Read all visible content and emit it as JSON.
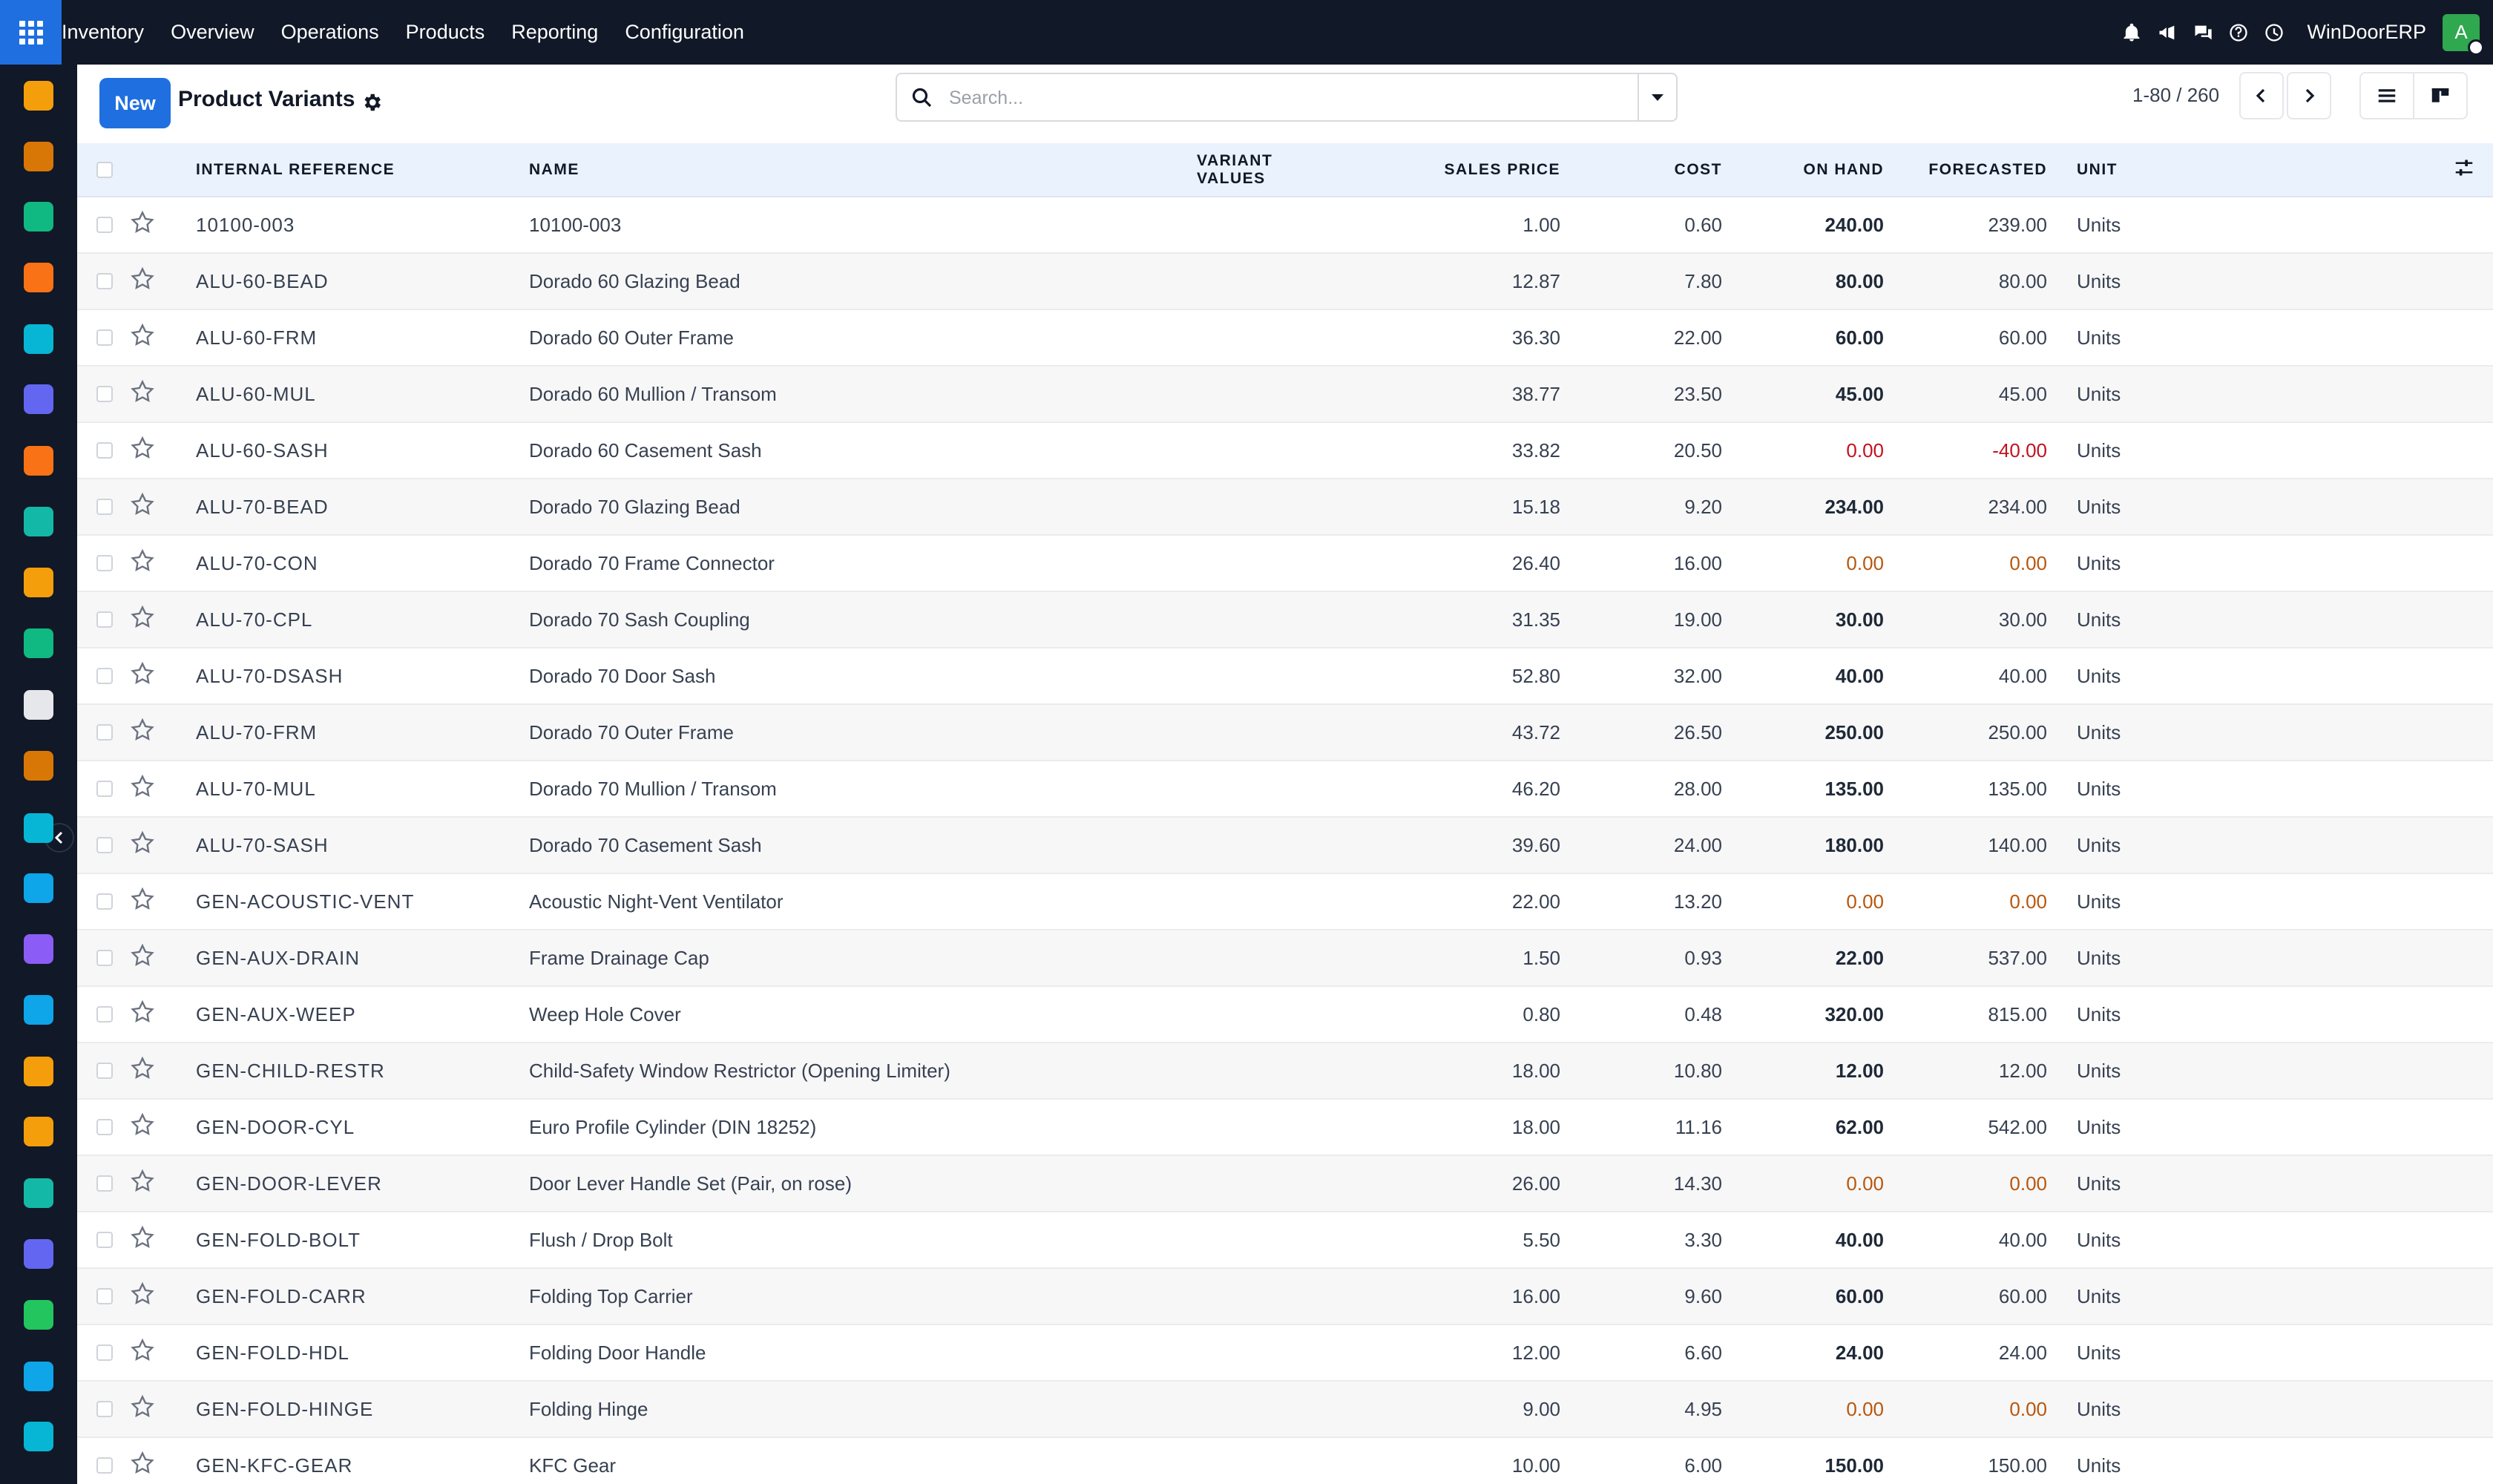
{
  "navbar": {
    "app_name": "Inventory",
    "menus": [
      "Overview",
      "Operations",
      "Products",
      "Reporting",
      "Configuration"
    ],
    "company": "WinDoorERP",
    "avatar_initial": "A",
    "icons": [
      "bell-icon",
      "megaphone-icon",
      "chat-icon",
      "help-icon",
      "clock-icon"
    ]
  },
  "sidebar": {
    "apps": [
      {
        "icon": "sales-chart-icon",
        "color": "#f59e0b"
      },
      {
        "icon": "pos-icon",
        "color": "#d97706"
      },
      {
        "icon": "contacts-icon",
        "color": "#10b981"
      },
      {
        "icon": "discuss-icon",
        "color": "#f97316"
      },
      {
        "icon": "website-icon",
        "color": "#06b6d4"
      },
      {
        "icon": "email-marketing-icon",
        "color": "#6366f1"
      },
      {
        "icon": "livechat-icon",
        "color": "#f97316"
      },
      {
        "icon": "purchase-icon",
        "color": "#14b8a6"
      },
      {
        "icon": "reporting-icon",
        "color": "#f59e0b"
      },
      {
        "icon": "employees-icon",
        "color": "#10b981"
      },
      {
        "icon": "inventory-box-icon",
        "color": "#e5e7eb"
      },
      {
        "icon": "point-of-sale-icon",
        "color": "#d97706"
      },
      {
        "icon": "project-icon",
        "color": "#06b6d4"
      },
      {
        "icon": "knowledge-icon",
        "color": "#0ea5e9"
      },
      {
        "icon": "barcode-icon",
        "color": "#8b5cf6"
      },
      {
        "icon": "invoicing-icon",
        "color": "#0ea5e9"
      },
      {
        "icon": "team-icon",
        "color": "#f59e0b"
      },
      {
        "icon": "calendar-icon",
        "color": "#f59e0b"
      },
      {
        "icon": "sign-icon",
        "color": "#14b8a6"
      },
      {
        "icon": "dashboard-icon",
        "color": "#6366f1"
      },
      {
        "icon": "whatsapp-icon",
        "color": "#22c55e"
      },
      {
        "icon": "timer-icon",
        "color": "#0ea5e9"
      },
      {
        "icon": "website-wave-icon",
        "color": "#06b6d4"
      }
    ]
  },
  "control": {
    "new_label": "New",
    "title": "Product Variants",
    "search_placeholder": "Search...",
    "pager": "1-80 / 260"
  },
  "table": {
    "columns": [
      "INTERNAL REFERENCE",
      "NAME",
      "VARIANT VALUES",
      "SALES PRICE",
      "COST",
      "ON HAND",
      "FORECASTED",
      "UNIT"
    ],
    "rows": [
      {
        "ref": "10100-003",
        "name": "10100-003",
        "variant": "",
        "price": "1.00",
        "cost": "0.60",
        "onhand": "240.00",
        "forecast": "239.00",
        "unit": "Units",
        "status": "ok"
      },
      {
        "ref": "ALU-60-BEAD",
        "name": "Dorado 60 Glazing Bead",
        "variant": "",
        "price": "12.87",
        "cost": "7.80",
        "onhand": "80.00",
        "forecast": "80.00",
        "unit": "Units",
        "status": "ok"
      },
      {
        "ref": "ALU-60-FRM",
        "name": "Dorado 60 Outer Frame",
        "variant": "",
        "price": "36.30",
        "cost": "22.00",
        "onhand": "60.00",
        "forecast": "60.00",
        "unit": "Units",
        "status": "ok"
      },
      {
        "ref": "ALU-60-MUL",
        "name": "Dorado 60 Mullion / Transom",
        "variant": "",
        "price": "38.77",
        "cost": "23.50",
        "onhand": "45.00",
        "forecast": "45.00",
        "unit": "Units",
        "status": "ok"
      },
      {
        "ref": "ALU-60-SASH",
        "name": "Dorado 60 Casement Sash",
        "variant": "",
        "price": "33.82",
        "cost": "20.50",
        "onhand": "0.00",
        "forecast": "-40.00",
        "unit": "Units",
        "status": "negative"
      },
      {
        "ref": "ALU-70-BEAD",
        "name": "Dorado 70 Glazing Bead",
        "variant": "",
        "price": "15.18",
        "cost": "9.20",
        "onhand": "234.00",
        "forecast": "234.00",
        "unit": "Units",
        "status": "ok"
      },
      {
        "ref": "ALU-70-CON",
        "name": "Dorado 70 Frame Connector",
        "variant": "",
        "price": "26.40",
        "cost": "16.00",
        "onhand": "0.00",
        "forecast": "0.00",
        "unit": "Units",
        "status": "zero"
      },
      {
        "ref": "ALU-70-CPL",
        "name": "Dorado 70 Sash Coupling",
        "variant": "",
        "price": "31.35",
        "cost": "19.00",
        "onhand": "30.00",
        "forecast": "30.00",
        "unit": "Units",
        "status": "ok"
      },
      {
        "ref": "ALU-70-DSASH",
        "name": "Dorado 70 Door Sash",
        "variant": "",
        "price": "52.80",
        "cost": "32.00",
        "onhand": "40.00",
        "forecast": "40.00",
        "unit": "Units",
        "status": "ok"
      },
      {
        "ref": "ALU-70-FRM",
        "name": "Dorado 70 Outer Frame",
        "variant": "",
        "price": "43.72",
        "cost": "26.50",
        "onhand": "250.00",
        "forecast": "250.00",
        "unit": "Units",
        "status": "ok"
      },
      {
        "ref": "ALU-70-MUL",
        "name": "Dorado 70 Mullion / Transom",
        "variant": "",
        "price": "46.20",
        "cost": "28.00",
        "onhand": "135.00",
        "forecast": "135.00",
        "unit": "Units",
        "status": "ok"
      },
      {
        "ref": "ALU-70-SASH",
        "name": "Dorado 70 Casement Sash",
        "variant": "",
        "price": "39.60",
        "cost": "24.00",
        "onhand": "180.00",
        "forecast": "140.00",
        "unit": "Units",
        "status": "ok"
      },
      {
        "ref": "GEN-ACOUSTIC-VENT",
        "name": "Acoustic Night-Vent Ventilator",
        "variant": "",
        "price": "22.00",
        "cost": "13.20",
        "onhand": "0.00",
        "forecast": "0.00",
        "unit": "Units",
        "status": "zero"
      },
      {
        "ref": "GEN-AUX-DRAIN",
        "name": "Frame Drainage Cap",
        "variant": "",
        "price": "1.50",
        "cost": "0.93",
        "onhand": "22.00",
        "forecast": "537.00",
        "unit": "Units",
        "status": "ok"
      },
      {
        "ref": "GEN-AUX-WEEP",
        "name": "Weep Hole Cover",
        "variant": "",
        "price": "0.80",
        "cost": "0.48",
        "onhand": "320.00",
        "forecast": "815.00",
        "unit": "Units",
        "status": "ok"
      },
      {
        "ref": "GEN-CHILD-RESTR",
        "name": "Child-Safety Window Restrictor (Opening Limiter)",
        "variant": "",
        "price": "18.00",
        "cost": "10.80",
        "onhand": "12.00",
        "forecast": "12.00",
        "unit": "Units",
        "status": "ok"
      },
      {
        "ref": "GEN-DOOR-CYL",
        "name": "Euro Profile Cylinder (DIN 18252)",
        "variant": "",
        "price": "18.00",
        "cost": "11.16",
        "onhand": "62.00",
        "forecast": "542.00",
        "unit": "Units",
        "status": "ok"
      },
      {
        "ref": "GEN-DOOR-LEVER",
        "name": "Door Lever Handle Set (Pair, on rose)",
        "variant": "",
        "price": "26.00",
        "cost": "14.30",
        "onhand": "0.00",
        "forecast": "0.00",
        "unit": "Units",
        "status": "zero"
      },
      {
        "ref": "GEN-FOLD-BOLT",
        "name": "Flush / Drop Bolt",
        "variant": "",
        "price": "5.50",
        "cost": "3.30",
        "onhand": "40.00",
        "forecast": "40.00",
        "unit": "Units",
        "status": "ok"
      },
      {
        "ref": "GEN-FOLD-CARR",
        "name": "Folding Top Carrier",
        "variant": "",
        "price": "16.00",
        "cost": "9.60",
        "onhand": "60.00",
        "forecast": "60.00",
        "unit": "Units",
        "status": "ok"
      },
      {
        "ref": "GEN-FOLD-HDL",
        "name": "Folding Door Handle",
        "variant": "",
        "price": "12.00",
        "cost": "6.60",
        "onhand": "24.00",
        "forecast": "24.00",
        "unit": "Units",
        "status": "ok"
      },
      {
        "ref": "GEN-FOLD-HINGE",
        "name": "Folding Hinge",
        "variant": "",
        "price": "9.00",
        "cost": "4.95",
        "onhand": "0.00",
        "forecast": "0.00",
        "unit": "Units",
        "status": "zero"
      },
      {
        "ref": "GEN-KFC-GEAR",
        "name": "KFC Gear",
        "variant": "",
        "price": "10.00",
        "cost": "6.00",
        "onhand": "150.00",
        "forecast": "150.00",
        "unit": "Units",
        "status": "ok"
      }
    ]
  }
}
